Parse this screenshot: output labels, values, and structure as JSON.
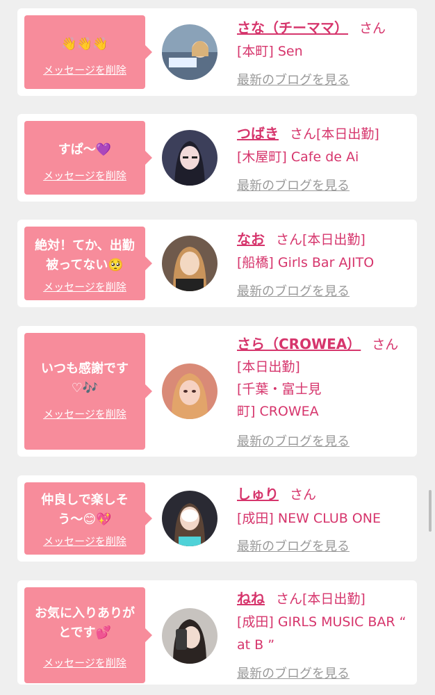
{
  "delete_label": "メッセージを削除",
  "blog_label": "最新のブログを見る",
  "colors": {
    "bubble": "#f78c9b",
    "accent": "#d6356c",
    "muted": "#999999"
  },
  "cards": [
    {
      "message": "👋👋👋",
      "name": "さな（チーママ）",
      "honorific": "さん",
      "status": "",
      "shop": "[本町] Sen"
    },
    {
      "message": "すぱ〜💜",
      "name": "つばき",
      "honorific": "さん",
      "status": "[本日出勤]",
      "shop": "[木屋町] Cafe de Ai"
    },
    {
      "message": "絶対！てか、出勤被ってない🥺",
      "name": "なお",
      "honorific": "さん",
      "status": "[本日出勤]",
      "shop": "[船橋] Girls Bar AJITO"
    },
    {
      "message": "いつも感謝です♡🎶",
      "name": "さら（CROWEA）",
      "honorific": "さん",
      "status": "[本日出勤]",
      "shop": "[千葉・富士見町] CROWEA"
    },
    {
      "message": "仲良しで楽しそう〜😊💖",
      "name": "しゅり",
      "honorific": "さん",
      "status": "",
      "shop": "[成田] NEW CLUB ONE"
    },
    {
      "message": "お気に入りありがとです💕",
      "name": "ねね",
      "honorific": "さん",
      "status": "[本日出勤]",
      "shop": "[成田] GIRLS MUSIC BAR “ at B ”"
    }
  ]
}
